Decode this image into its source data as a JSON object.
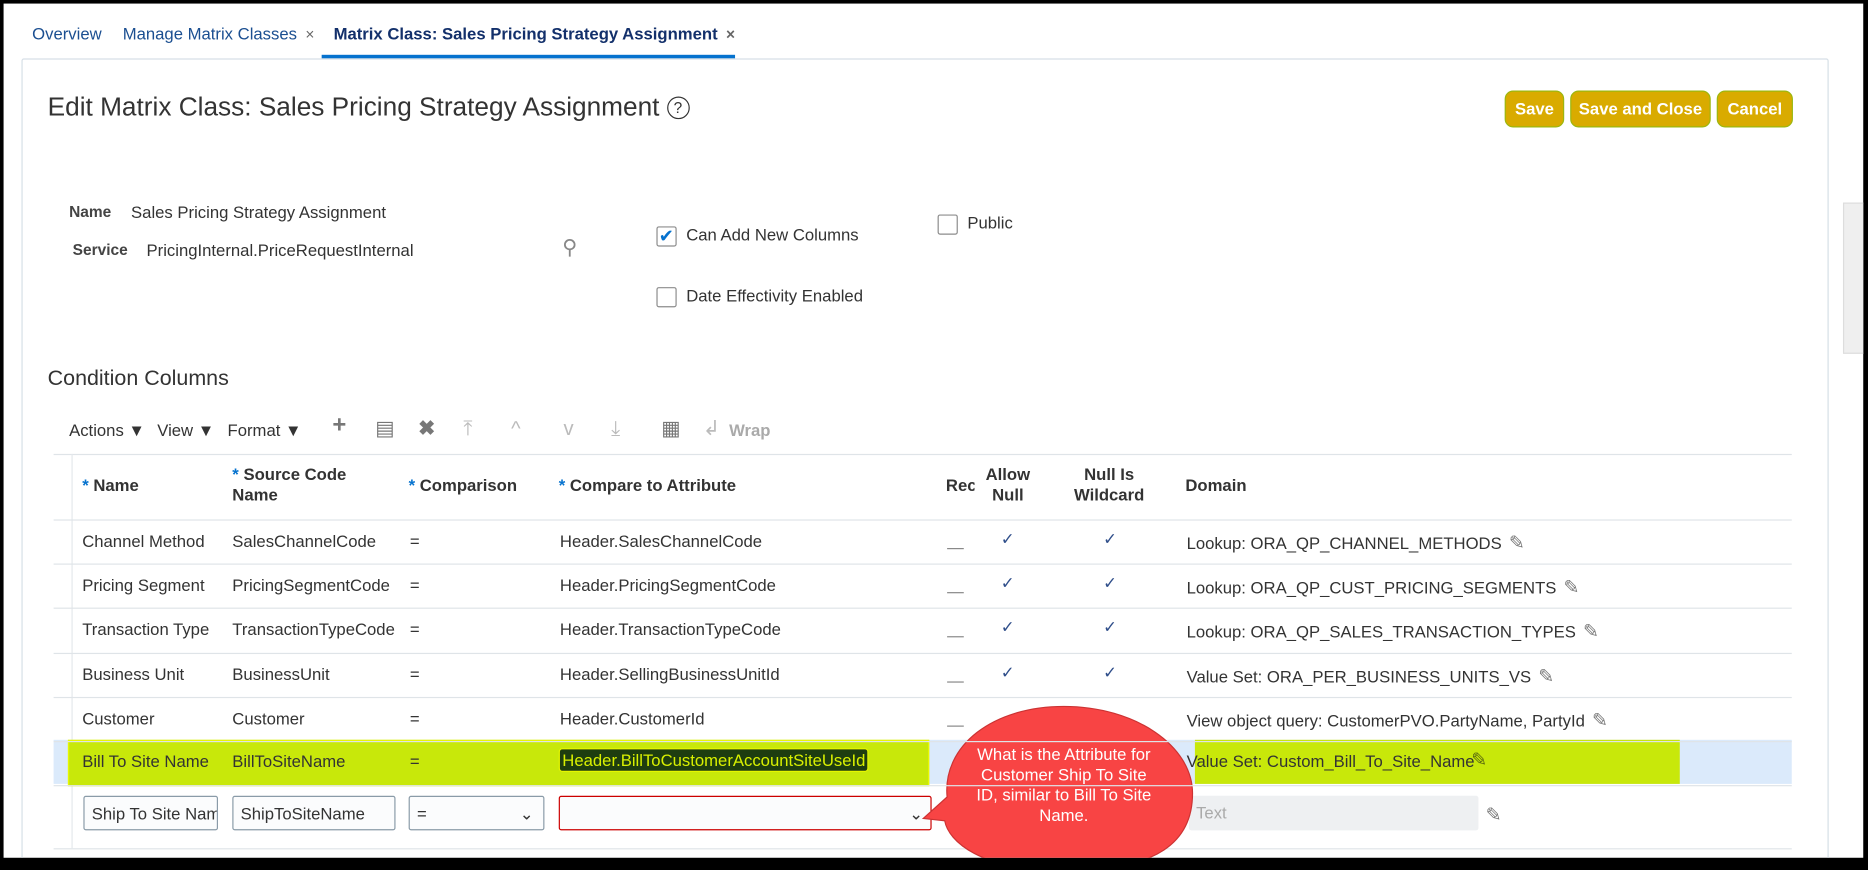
{
  "tabs": [
    {
      "label": "Overview"
    },
    {
      "label": "Manage Matrix Classes",
      "close": "×"
    },
    {
      "label": "Matrix Class: Sales Pricing Strategy Assignment",
      "close": "×"
    }
  ],
  "page_title": "Edit Matrix Class: Sales Pricing Strategy Assignment",
  "help_icon": "?",
  "buttons": {
    "save": "Save",
    "save_close": "Save and Close",
    "cancel": "Cancel"
  },
  "form": {
    "name_label": "Name",
    "name_value": "Sales Pricing Strategy Assignment",
    "service_label": "Service",
    "service_value": "PricingInternal.PriceRequestInternal",
    "can_add_columns": {
      "label": "Can Add New Columns",
      "checked": true
    },
    "date_effectivity": {
      "label": "Date Effectivity Enabled",
      "checked": false
    },
    "public": {
      "label": "Public",
      "checked": false
    }
  },
  "section_title": "Condition Columns",
  "toolbar": {
    "actions": "Actions ▼",
    "view": "View ▼",
    "format": "Format ▼",
    "wrap": "Wrap"
  },
  "table": {
    "headers": {
      "name": "Name",
      "source": "Source Code Name",
      "comparison": "Comparison",
      "compare_attr": "Compare to Attribute",
      "required": "Rec",
      "allow_null": "Allow Null",
      "null_wildcard": "Null Is Wildcard",
      "domain": "Domain",
      "star": "*"
    },
    "rows": [
      {
        "name": "Channel Method",
        "source": "SalesChannelCode",
        "comparison": "=",
        "attr": "Header.SalesChannelCode",
        "allow_null": "✓",
        "wildcard": "✓",
        "domain": "Lookup: ORA_QP_CHANNEL_METHODS"
      },
      {
        "name": "Pricing Segment",
        "source": "PricingSegmentCode",
        "comparison": "=",
        "attr": "Header.PricingSegmentCode",
        "allow_null": "✓",
        "wildcard": "✓",
        "domain": "Lookup: ORA_QP_CUST_PRICING_SEGMENTS"
      },
      {
        "name": "Transaction Type",
        "source": "TransactionTypeCode",
        "comparison": "=",
        "attr": "Header.TransactionTypeCode",
        "allow_null": "✓",
        "wildcard": "✓",
        "domain": "Lookup: ORA_QP_SALES_TRANSACTION_TYPES"
      },
      {
        "name": "Business Unit",
        "source": "BusinessUnit",
        "comparison": "=",
        "attr": "Header.SellingBusinessUnitId",
        "allow_null": "✓",
        "wildcard": "✓",
        "domain": "Value Set: ORA_PER_BUSINESS_UNITS_VS"
      },
      {
        "name": "Customer",
        "source": "Customer",
        "comparison": "=",
        "attr": "Header.CustomerId",
        "allow_null": "",
        "wildcard": "",
        "domain": "View object query: CustomerPVO.PartyName, PartyId"
      },
      {
        "name": "Bill To Site Name",
        "source": "BillToSiteName",
        "comparison": "=",
        "attr": "Header.BillToCustomerAccountSiteUseId",
        "allow_null": "",
        "wildcard": "",
        "domain": "Value Set: Custom_Bill_To_Site_Name"
      }
    ],
    "new_row": {
      "name": "Ship To Site Nam",
      "source": "ShipToSiteName",
      "comparison": "=",
      "attr": "",
      "domain_placeholder": "Text"
    }
  },
  "callout": "What is the Attribute for Customer Ship To Site ID, similar to Bill To Site Name.",
  "colors": {
    "accent": "#0572ce",
    "button": "#d9ab00",
    "highlight": "#c8e80a",
    "callout": "#f84444",
    "selected_row": "#dbeafb"
  }
}
